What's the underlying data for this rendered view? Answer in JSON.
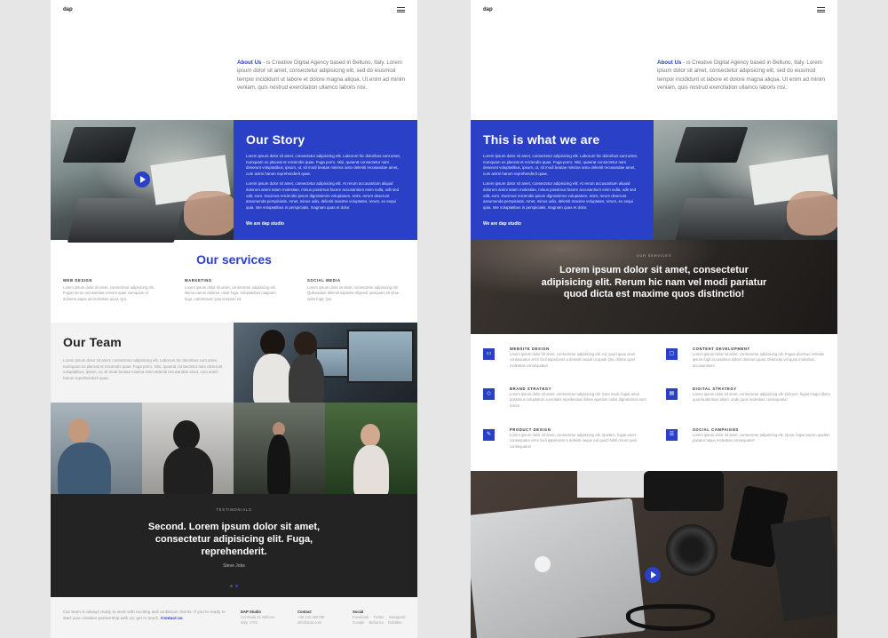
{
  "logo": "dap",
  "about": {
    "label": "About Us",
    "text": " - is Creative Digital Agency based in Belluno, Italy. Lorem ipsum dolor sit amet, consectetur adipisicing elit, sed do eiusmod tempor incididunt ut labore et dolore magna aliqua. Ut enim ad minim veniam, quis nostrud exercitation ullamco laboris nisi."
  },
  "pageA": {
    "story": {
      "title": "Our Story",
      "p1": "Lorem ipsum dolor sit amet, consectetur adipisicing elit. Laborum hic doloribus sunt amet, numquam ex placeat et reiciendis quae. Fuga porro. Nisi, quaerat consectetur nam deserunt voluptatibus, ipsum, ut, sit modi beatae minima iusto deleniti recusandae amet, cum animi harum reprehenderit quae.",
      "p2": "Lorem ipsum dolor sit amet, consectetur adipisicing elit. At rerum accusantium aliquid dolorum animi totam molestiae, minus possimus facere accusantium enim nulla, odit sed odit, eum. Ducimus reiciendis ipsum dignissimos voluptatum, enim, rerum deserunt assumenda perspiciatis. Amet, minus odio, deleniti maxime voluptates, rerum, ex sequi quia. Iste voluptatibus in perspiciatis, magnam quas et dolor.",
      "link": "We are dap studio"
    },
    "services": {
      "title": "Our services",
      "cols": [
        {
          "h": "WEB DESIGN",
          "t": "Lorem ipsum dolor sit amet, consectetur adipisicing elit. Fugiat nemo recusandae veniam quae numquam et dolorem atque ad molestias quod. Qui."
        },
        {
          "h": "MARKETING",
          "t": "Lorem ipsum dolor sit amet, consectetur adipisicing elit. Nemo earum dolores, unde fuga. Voluptatibus magnam fuga. Laboriosam ipsa tempore sit."
        },
        {
          "h": "SOCIAL MEDIA",
          "t": "Lorem ipsum dolor sit amet, consectetur adipisicing elit. Quibusdam deleniti sapiente eligendi quisquam sit vitae optio fugit. Qui."
        }
      ]
    },
    "team": {
      "title": "Our Team",
      "text": "Lorem ipsum dolor sit amet, consectetur adipisicing elit. Laborum hic doloribus sunt amet, numquam ex placeat et reiciendis quae. Fuga porro. Nisi, quaerat consectetur nam deserunt voluptatibus, ipsum, ut, sit modi beatae minima iusto deleniti recusandae amet, cum animi harum reprehenderit quae."
    },
    "testimonial": {
      "label": "TESTIMONIALS",
      "quote": "Second. Lorem ipsum dolor sit amet, consectetur adipisicing elit. Fuga, reprehenderit.",
      "author": "Steve Jobs"
    },
    "footer": {
      "intro": "Our team is always ready to work with exciting and ambitious clients. If you're ready to start your creative partnership with us, get in touch.",
      "contact": "Contact us",
      "studio": {
        "h": "DAP Studio",
        "l1": "Contrada 31 Belluno",
        "l2": "Italy, 1701"
      },
      "contacts": {
        "h": "Contact",
        "l1": "+39 123 456789",
        "l2": "info@dap.com"
      },
      "social": {
        "h": "Social",
        "l1": "Facebook",
        "l2": "Twitter",
        "l3": "Instagram",
        "l4": "Google",
        "l5": "Behance",
        "l6": "Dribbble"
      }
    }
  },
  "pageB": {
    "what": {
      "title": "This is what we are",
      "p1": "Lorem ipsum dolor sit amet, consectetur adipisicing elit. Laborum hic doloribus sunt amet, numquam ex placeat et reiciendis quae. Fuga porro. Nisi, quaerat consectetur nam deserunt voluptatibus, ipsum, ut, sit modi beatae minima iusto deleniti recusandae amet, cum animi harum reprehenderit quae.",
      "p2": "Lorem ipsum dolor sit amet, consectetur adipisicing elit. At rerum accusantium aliquid dolorum animi totam molestiae, minus possimus facere accusantium enim nulla, odit sed odit, eum. Ducimus reiciendis ipsum dignissimos voluptatum, enim, rerum deserunt assumenda perspiciatis. Amet, minus odio, deleniti maxime voluptates, rerum, ex sequi quia. Iste voluptatibus in perspiciatis, magnam quas et dolor.",
      "link": "We are dap studio"
    },
    "services_banner": {
      "label": "OUR SERVICES",
      "quote": "Lorem ipsum dolor sit amet, consectetur adipisicing elit. Rerum hic nam vel modi pariatur quod dicta est maxime quos distinctio!"
    },
    "features": [
      {
        "h": "WEBSITE DESIGN",
        "t": "Lorem ipsum dolor sit amet, consectetur adipisicing elit. Ad, quod quae amet consequatur error facil asperiores a deleniti neque ut quod! Qui, dolore quos molestias consequatur!"
      },
      {
        "h": "CONTENT DEVELOPMENT",
        "t": "Lorem ipsum dolor sit amet, consectetur adipisicing elit. Fugiat ducimus veritatis ipsum fugit accusamus dolore dolorum quas. Distinctio vel quos molestias, accusantium!"
      },
      {
        "h": "BRAND STRATEGY",
        "t": "Lorem ipsum dolor sit amet, consectetur adipisicing elit. Sunt modi, fugiat amet possimus voluptatum a veritatis repellendus dolore aperiam nobis dignissimos eum rerum."
      },
      {
        "h": "DIGITAL STRATEGY",
        "t": "Lorem ipsum dolor sit amet, consectetur adipisicing elit. Dolores, fugiat magni libero quia laudantium ullam, unde quos molestias consequatur!"
      },
      {
        "h": "PRODUCT DESIGN",
        "t": "Lorem ipsum dolor sit amet, consectetur adipisicing elit. Quidem, fugiat amet consequatur error facil asperiores a deleniti neque aut quod! Nihil rerum quos consequatur!"
      },
      {
        "h": "SOCIAL CAMPAIGNS",
        "t": "Lorem ipsum dolor sit amet, consectetur adipisicing elit. Quos, fugiat earum quidem pariatur atque molestias consequatur!"
      }
    ]
  },
  "colors": {
    "accent": "#2a41c7",
    "dark": "#232323",
    "light": "#f3f3f3"
  },
  "icons": [
    "play-icon",
    "menu-icon"
  ]
}
